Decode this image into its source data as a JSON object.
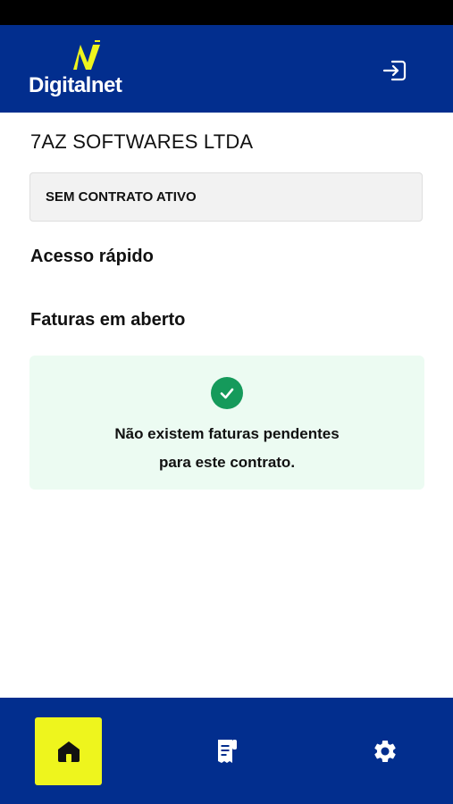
{
  "brand": {
    "name": "Digitalnet",
    "header_color": "#022e8e",
    "accent_color": "#eef51d",
    "logo_icon": "digitalnet-logo-icon"
  },
  "header": {
    "logout_icon": "logout-icon"
  },
  "company_name": "7AZ SOFTWARES LTDA",
  "contract_status": "SEM CONTRATO ATIVO",
  "quick_access": {
    "title": "Acesso rápido"
  },
  "open_invoices": {
    "title": "Faturas em aberto",
    "empty_icon": "check-circle-icon",
    "empty_message_line1": "Não existem faturas pendentes",
    "empty_message_line2": "para este contrato.",
    "success_color": "#159a5b",
    "background_color": "#ecfbf2"
  },
  "bottom_nav": {
    "items": [
      {
        "icon": "home-icon",
        "active": true
      },
      {
        "icon": "invoice-icon",
        "active": false
      },
      {
        "icon": "gear-icon",
        "active": false
      }
    ]
  }
}
